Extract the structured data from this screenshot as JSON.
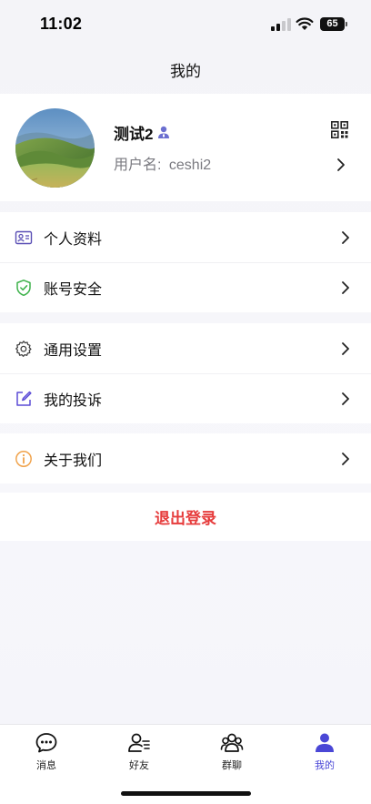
{
  "status_bar": {
    "time": "11:02",
    "battery": "65",
    "icons": [
      "signal-icon",
      "wifi-icon",
      "battery-icon"
    ]
  },
  "header": {
    "title": "我的"
  },
  "profile": {
    "name": "测试2",
    "username_label": "用户名:",
    "username": "ceshi2",
    "icons": [
      "user-badge-icon",
      "qr-code-icon",
      "chevron-right-icon"
    ]
  },
  "menu": {
    "group1": [
      {
        "label": "个人资料",
        "icon": "id-card-icon"
      },
      {
        "label": "账号安全",
        "icon": "shield-check-icon"
      }
    ],
    "group2": [
      {
        "label": "通用设置",
        "icon": "gear-icon"
      },
      {
        "label": "我的投诉",
        "icon": "edit-icon"
      }
    ],
    "group3": [
      {
        "label": "关于我们",
        "icon": "info-icon"
      }
    ]
  },
  "logout": {
    "label": "退出登录"
  },
  "tabs": [
    {
      "label": "消息",
      "icon": "chat-icon"
    },
    {
      "label": "好友",
      "icon": "friends-icon"
    },
    {
      "label": "群聊",
      "icon": "group-icon"
    },
    {
      "label": "我的",
      "icon": "user-icon",
      "active": true
    }
  ],
  "colors": {
    "accent": "#4a47d6",
    "logout": "#e63c3c",
    "shield": "#3db24a",
    "info": "#f0a24a",
    "edit": "#5b4bd6",
    "id_card": "#5a4fb5"
  }
}
